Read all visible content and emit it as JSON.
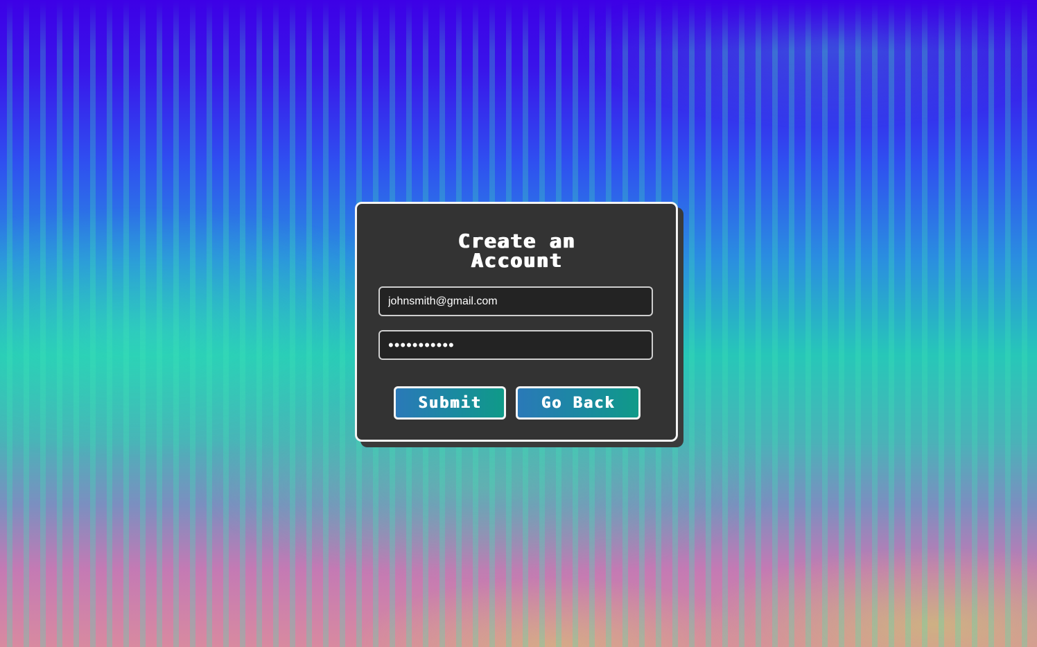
{
  "colors": {
    "card_background": "#333333",
    "card_border": "#f4f4f4",
    "input_background": "#232323",
    "button_gradient_start": "#2a79b8",
    "button_gradient_end": "#0f9a88",
    "background_top": "#3d00e6"
  },
  "form": {
    "title_line1": "Create an",
    "title_line2": "Account",
    "email_value": "johnsmith@gmail.com",
    "password_value": "•••••••••••",
    "submit_label": "Submit",
    "back_label": "Go Back"
  }
}
